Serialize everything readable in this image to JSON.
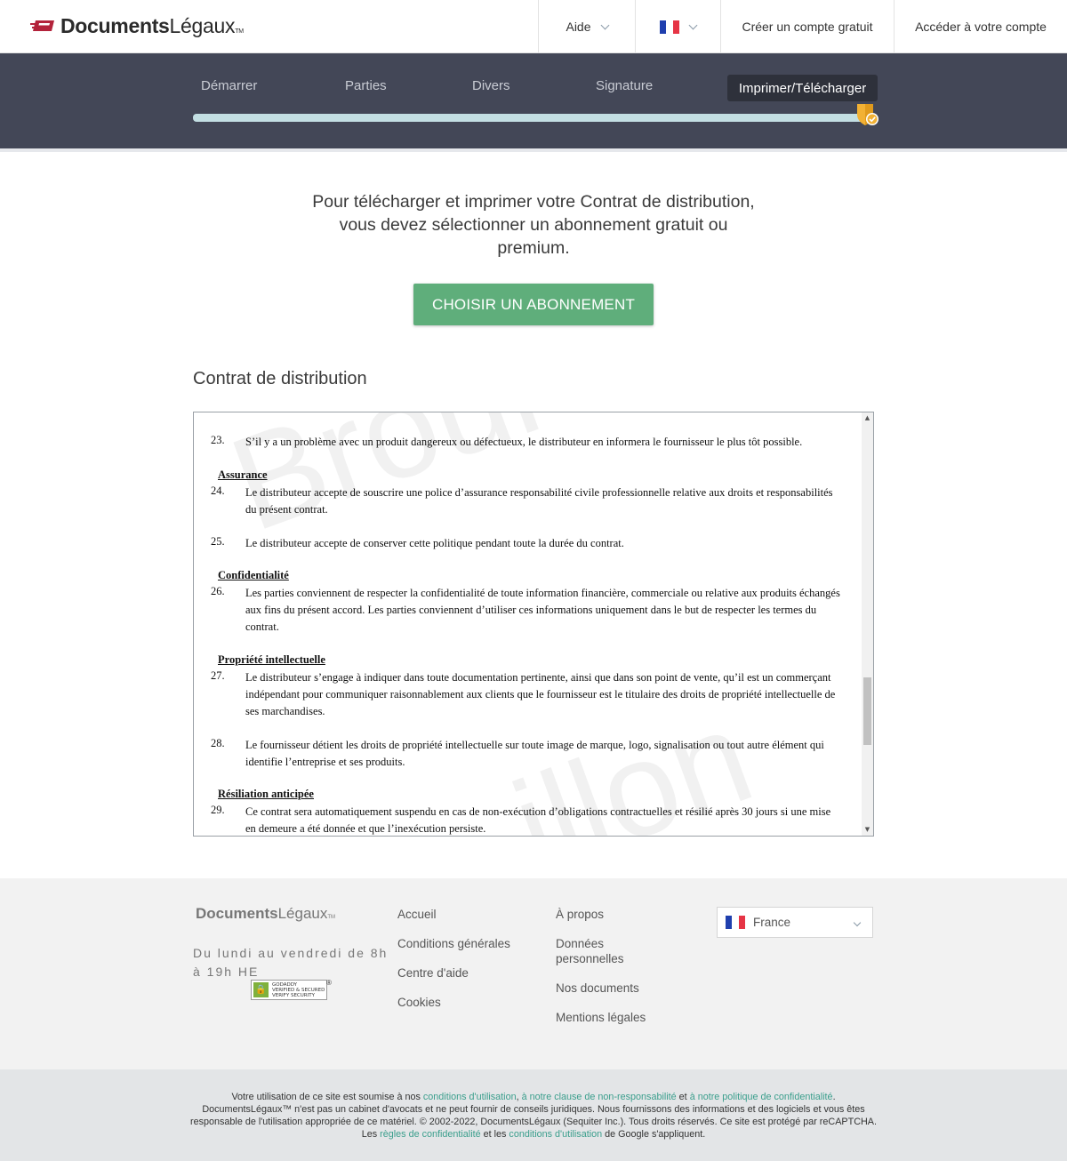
{
  "header": {
    "logo_main": "Documents",
    "logo_sub": "Légaux",
    "logo_tm": "TM",
    "nav_help": "Aide",
    "nav_create": "Créer un compte gratuit",
    "nav_login": "Accéder à votre compte",
    "lang_icon": "france-flag-icon"
  },
  "steps": {
    "items": [
      "Démarrer",
      "Parties",
      "Divers",
      "Signature"
    ],
    "active": "Imprimer/Télécharger",
    "progress": 1.0
  },
  "main": {
    "intro": "Pour télécharger et imprimer votre Contrat de distribution, vous devez sélectionner un abonnement gratuit ou premium.",
    "cta": "CHOISIR UN ABONNEMENT",
    "doc_title": "Contrat de distribution",
    "watermark_top": "Broui",
    "watermark_bottom": "illon"
  },
  "document": {
    "clause_23_num": "23.",
    "clause_23": "S’il y a un problème avec un produit dangereux ou défectueux, le distributeur en informera le fournisseur le plus tôt possible.",
    "h_assurance": "Assurance",
    "clause_24_num": "24.",
    "clause_24": "Le distributeur accepte de souscrire une police d’assurance responsabilité civile professionnelle relative aux droits et responsabilités du présent contrat.",
    "clause_25_num": "25.",
    "clause_25": "Le distributeur accepte de conserver cette politique pendant toute la durée du contrat.",
    "h_confidentialite": "Confidentialité",
    "clause_26_num": "26.",
    "clause_26": "Les parties conviennent de respecter la confidentialité de toute information financière, commerciale ou relative aux produits échangés aux fins du présent accord. Les parties conviennent d’utiliser ces informations uniquement dans le but de respecter les termes du contrat.",
    "h_propriete": "Propriété intellectuelle",
    "clause_27_num": "27.",
    "clause_27": "Le distributeur s’engage à indiquer dans toute documentation pertinente, ainsi que dans son point de vente, qu’il est un commerçant indépendant pour communiquer raisonnablement aux clients que le fournisseur est le titulaire des droits de propriété intellectuelle de ses marchandises.",
    "clause_28_num": "28.",
    "clause_28": "Le fournisseur détient les droits de propriété intellectuelle sur toute image de marque, logo, signalisation ou tout autre élément qui identifie l’entreprise et ses produits.",
    "h_resiliation": "Résiliation anticipée",
    "clause_29_num": "29.",
    "clause_29": "Ce contrat sera automatiquement suspendu en cas de non-exécution d’obligations contractuelles et résilié après 30 jours si une mise en demeure a été donnée et que l’inexécution persiste."
  },
  "footer": {
    "logo_main": "Documents",
    "logo_sub": "Légaux",
    "logo_tm": "TM",
    "hours": "Du lundi au vendredi de 8h à 19h HE",
    "badge_line1": "GODADDY",
    "badge_line2": "VERIFIED & SECURED",
    "badge_line3": "VERIFY SECURITY",
    "badge_reg": "®",
    "col1": [
      "Accueil",
      "Conditions générales",
      "Centre d'aide",
      "Cookies"
    ],
    "col2_0": "À propos",
    "col2_1": "Données personnelles",
    "col2_2": "Nos documents",
    "col2_3": "Mentions légales",
    "country": "France"
  },
  "legal": {
    "l1_a": "Votre utilisation de ce site est soumise à nos ",
    "l1_link1": "conditions d'utilisation",
    "l1_b": ", ",
    "l1_link2": "à notre clause de non-responsabilité",
    "l1_c": " et ",
    "l1_link3": "à notre politique de confidentialité",
    "l1_d": ".",
    "l2": "DocumentsLégaux™ n'est pas un cabinet d'avocats et ne peut fournir de conseils juridiques. Nous fournissons des informations et des logiciels et vous êtes responsable de l'utilisation appropriée de ce matériel. © 2002-2022, DocumentsLégaux (Sequiter Inc.). Tous droits réservés. Ce site est protégé par reCAPTCHA.",
    "l3_a": "Les ",
    "l3_link1": "règles de confidentialité",
    "l3_b": " et les ",
    "l3_link2": "conditions d'utilisation",
    "l3_c": " de Google s'appliquent."
  },
  "colors": {
    "band": "#434757",
    "cta": "#5fae7b",
    "link": "#3a9e8c",
    "track": "#c3dfe3",
    "shield": "#f2b134"
  }
}
